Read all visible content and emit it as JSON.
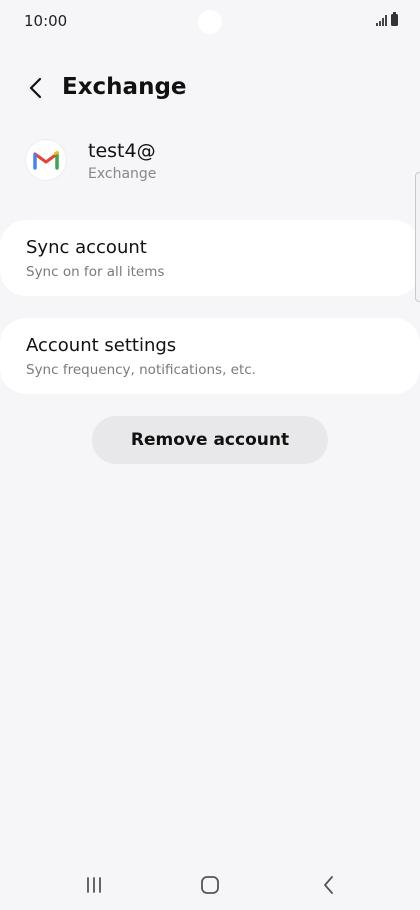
{
  "status_bar": {
    "time": "10:00",
    "icons": [
      "signal-icon",
      "battery-icon"
    ]
  },
  "header": {
    "title": "Exchange",
    "back_icon": "back-arrow-icon"
  },
  "account": {
    "email": "test4@",
    "type": "Exchange",
    "logo_icon": "gmail-icon"
  },
  "settings": [
    {
      "title": "Sync account",
      "subtitle": "Sync on for all items"
    },
    {
      "title": "Account settings",
      "subtitle": "Sync frequency, notifications, etc."
    }
  ],
  "remove_button": {
    "label": "Remove account"
  },
  "navigation": {
    "icons": [
      "recent-apps-icon",
      "home-icon",
      "back-icon"
    ]
  },
  "colors": {
    "background": "#f6f6f8",
    "card": "#ffffff",
    "button": "#e8e8ea",
    "gmail_red": "#EA4335",
    "gmail_blue": "#4285F4",
    "gmail_green": "#34A853",
    "gmail_yellow": "#FBBC04"
  }
}
